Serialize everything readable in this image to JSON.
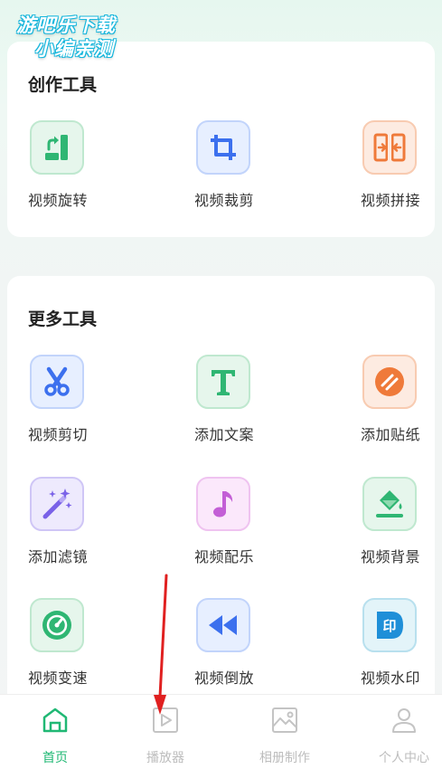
{
  "watermark": {
    "line1": "游吧乐下载",
    "line2": "小编亲测"
  },
  "sections": [
    {
      "title": "创作工具",
      "tools": [
        {
          "label": "视频旋转",
          "icon": "rotate-icon",
          "color": "#2fb673"
        },
        {
          "label": "视频裁剪",
          "icon": "crop-icon",
          "color": "#3c70ee"
        },
        {
          "label": "视频拼接",
          "icon": "merge-icon",
          "color": "#ef7a3a"
        }
      ]
    },
    {
      "title": "更多工具",
      "tools": [
        {
          "label": "视频剪切",
          "icon": "scissors-icon",
          "color": "#3c70ee"
        },
        {
          "label": "添加文案",
          "icon": "text-icon",
          "color": "#2fb673"
        },
        {
          "label": "添加贴纸",
          "icon": "sticker-icon",
          "color": "#ef7a3a"
        },
        {
          "label": "添加滤镜",
          "icon": "magic-wand-icon",
          "color": "#7a62e8"
        },
        {
          "label": "视频配乐",
          "icon": "music-note-icon",
          "color": "#c35fd6"
        },
        {
          "label": "视频背景",
          "icon": "paint-bucket-icon",
          "color": "#2fb673"
        },
        {
          "label": "视频变速",
          "icon": "speedometer-icon",
          "color": "#2fb673"
        },
        {
          "label": "视频倒放",
          "icon": "rewind-icon",
          "color": "#3c70ee"
        },
        {
          "label": "视频水印",
          "icon": "watermark-icon",
          "color": "#1f8fd8"
        }
      ]
    }
  ],
  "tabbar": {
    "active_color": "#20b874",
    "inactive_color": "#bdbdbd",
    "tabs": [
      {
        "label": "首页",
        "icon": "home-icon",
        "active": true
      },
      {
        "label": "播放器",
        "icon": "player-icon",
        "active": false
      },
      {
        "label": "相册制作",
        "icon": "album-icon",
        "active": false
      },
      {
        "label": "个人中心",
        "icon": "profile-icon",
        "active": false
      }
    ]
  }
}
